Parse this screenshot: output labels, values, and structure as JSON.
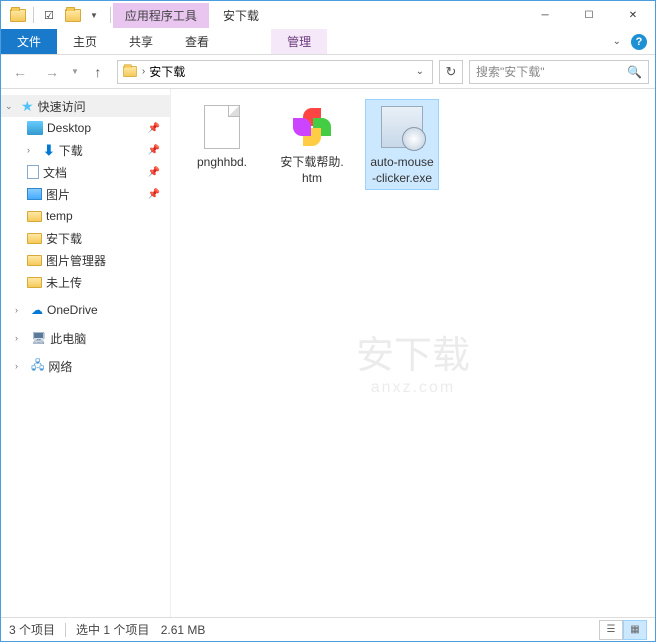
{
  "titlebar": {
    "context_tab": "应用程序工具",
    "window_title": "安下载"
  },
  "ribbon": {
    "file": "文件",
    "home": "主页",
    "share": "共享",
    "view": "查看",
    "manage": "管理"
  },
  "nav": {
    "path_root": "安下载",
    "search_placeholder": "搜索\"安下载\""
  },
  "tree": {
    "quick_access": "快速访问",
    "desktop": "Desktop",
    "downloads": "下载",
    "documents": "文档",
    "pictures": "图片",
    "temp": "temp",
    "anxz": "安下载",
    "picmgr": "图片管理器",
    "unuploaded": "未上传",
    "onedrive": "OneDrive",
    "this_pc": "此电脑",
    "network": "网络"
  },
  "files": [
    {
      "name": "pnghhbd."
    },
    {
      "name": "安下载帮助.htm"
    },
    {
      "name": "auto-mouse-clicker.exe"
    }
  ],
  "status": {
    "count": "3 个项目",
    "selection": "选中 1 个项目",
    "size": "2.61 MB"
  },
  "watermark": {
    "main": "安下载",
    "sub": "anxz.com"
  }
}
